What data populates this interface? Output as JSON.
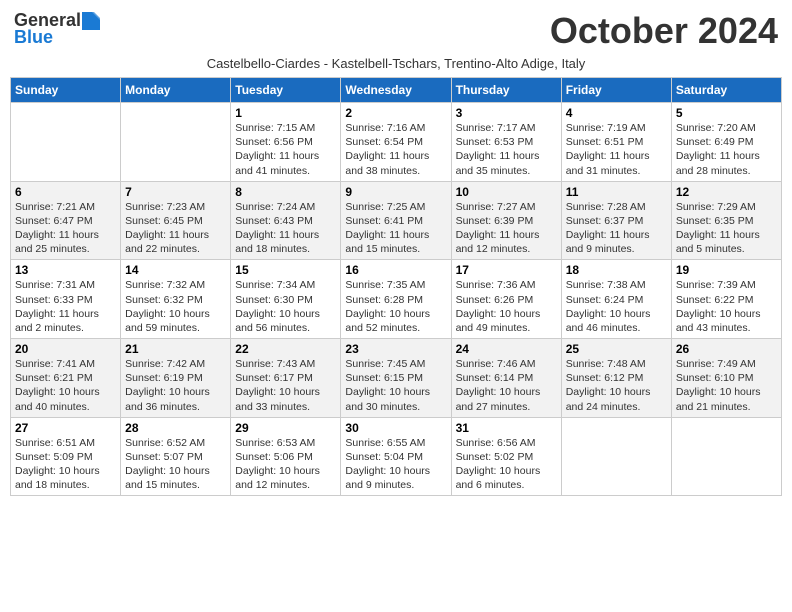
{
  "logo": {
    "general": "General",
    "blue": "Blue"
  },
  "title": "October 2024",
  "subtitle": "Castelbello-Ciardes - Kastelbell-Tschars, Trentino-Alto Adige, Italy",
  "weekdays": [
    "Sunday",
    "Monday",
    "Tuesday",
    "Wednesday",
    "Thursday",
    "Friday",
    "Saturday"
  ],
  "weeks": [
    [
      {
        "day": "",
        "info": ""
      },
      {
        "day": "",
        "info": ""
      },
      {
        "day": "1",
        "info": "Sunrise: 7:15 AM\nSunset: 6:56 PM\nDaylight: 11 hours and 41 minutes."
      },
      {
        "day": "2",
        "info": "Sunrise: 7:16 AM\nSunset: 6:54 PM\nDaylight: 11 hours and 38 minutes."
      },
      {
        "day": "3",
        "info": "Sunrise: 7:17 AM\nSunset: 6:53 PM\nDaylight: 11 hours and 35 minutes."
      },
      {
        "day": "4",
        "info": "Sunrise: 7:19 AM\nSunset: 6:51 PM\nDaylight: 11 hours and 31 minutes."
      },
      {
        "day": "5",
        "info": "Sunrise: 7:20 AM\nSunset: 6:49 PM\nDaylight: 11 hours and 28 minutes."
      }
    ],
    [
      {
        "day": "6",
        "info": "Sunrise: 7:21 AM\nSunset: 6:47 PM\nDaylight: 11 hours and 25 minutes."
      },
      {
        "day": "7",
        "info": "Sunrise: 7:23 AM\nSunset: 6:45 PM\nDaylight: 11 hours and 22 minutes."
      },
      {
        "day": "8",
        "info": "Sunrise: 7:24 AM\nSunset: 6:43 PM\nDaylight: 11 hours and 18 minutes."
      },
      {
        "day": "9",
        "info": "Sunrise: 7:25 AM\nSunset: 6:41 PM\nDaylight: 11 hours and 15 minutes."
      },
      {
        "day": "10",
        "info": "Sunrise: 7:27 AM\nSunset: 6:39 PM\nDaylight: 11 hours and 12 minutes."
      },
      {
        "day": "11",
        "info": "Sunrise: 7:28 AM\nSunset: 6:37 PM\nDaylight: 11 hours and 9 minutes."
      },
      {
        "day": "12",
        "info": "Sunrise: 7:29 AM\nSunset: 6:35 PM\nDaylight: 11 hours and 5 minutes."
      }
    ],
    [
      {
        "day": "13",
        "info": "Sunrise: 7:31 AM\nSunset: 6:33 PM\nDaylight: 11 hours and 2 minutes."
      },
      {
        "day": "14",
        "info": "Sunrise: 7:32 AM\nSunset: 6:32 PM\nDaylight: 10 hours and 59 minutes."
      },
      {
        "day": "15",
        "info": "Sunrise: 7:34 AM\nSunset: 6:30 PM\nDaylight: 10 hours and 56 minutes."
      },
      {
        "day": "16",
        "info": "Sunrise: 7:35 AM\nSunset: 6:28 PM\nDaylight: 10 hours and 52 minutes."
      },
      {
        "day": "17",
        "info": "Sunrise: 7:36 AM\nSunset: 6:26 PM\nDaylight: 10 hours and 49 minutes."
      },
      {
        "day": "18",
        "info": "Sunrise: 7:38 AM\nSunset: 6:24 PM\nDaylight: 10 hours and 46 minutes."
      },
      {
        "day": "19",
        "info": "Sunrise: 7:39 AM\nSunset: 6:22 PM\nDaylight: 10 hours and 43 minutes."
      }
    ],
    [
      {
        "day": "20",
        "info": "Sunrise: 7:41 AM\nSunset: 6:21 PM\nDaylight: 10 hours and 40 minutes."
      },
      {
        "day": "21",
        "info": "Sunrise: 7:42 AM\nSunset: 6:19 PM\nDaylight: 10 hours and 36 minutes."
      },
      {
        "day": "22",
        "info": "Sunrise: 7:43 AM\nSunset: 6:17 PM\nDaylight: 10 hours and 33 minutes."
      },
      {
        "day": "23",
        "info": "Sunrise: 7:45 AM\nSunset: 6:15 PM\nDaylight: 10 hours and 30 minutes."
      },
      {
        "day": "24",
        "info": "Sunrise: 7:46 AM\nSunset: 6:14 PM\nDaylight: 10 hours and 27 minutes."
      },
      {
        "day": "25",
        "info": "Sunrise: 7:48 AM\nSunset: 6:12 PM\nDaylight: 10 hours and 24 minutes."
      },
      {
        "day": "26",
        "info": "Sunrise: 7:49 AM\nSunset: 6:10 PM\nDaylight: 10 hours and 21 minutes."
      }
    ],
    [
      {
        "day": "27",
        "info": "Sunrise: 6:51 AM\nSunset: 5:09 PM\nDaylight: 10 hours and 18 minutes."
      },
      {
        "day": "28",
        "info": "Sunrise: 6:52 AM\nSunset: 5:07 PM\nDaylight: 10 hours and 15 minutes."
      },
      {
        "day": "29",
        "info": "Sunrise: 6:53 AM\nSunset: 5:06 PM\nDaylight: 10 hours and 12 minutes."
      },
      {
        "day": "30",
        "info": "Sunrise: 6:55 AM\nSunset: 5:04 PM\nDaylight: 10 hours and 9 minutes."
      },
      {
        "day": "31",
        "info": "Sunrise: 6:56 AM\nSunset: 5:02 PM\nDaylight: 10 hours and 6 minutes."
      },
      {
        "day": "",
        "info": ""
      },
      {
        "day": "",
        "info": ""
      }
    ]
  ]
}
